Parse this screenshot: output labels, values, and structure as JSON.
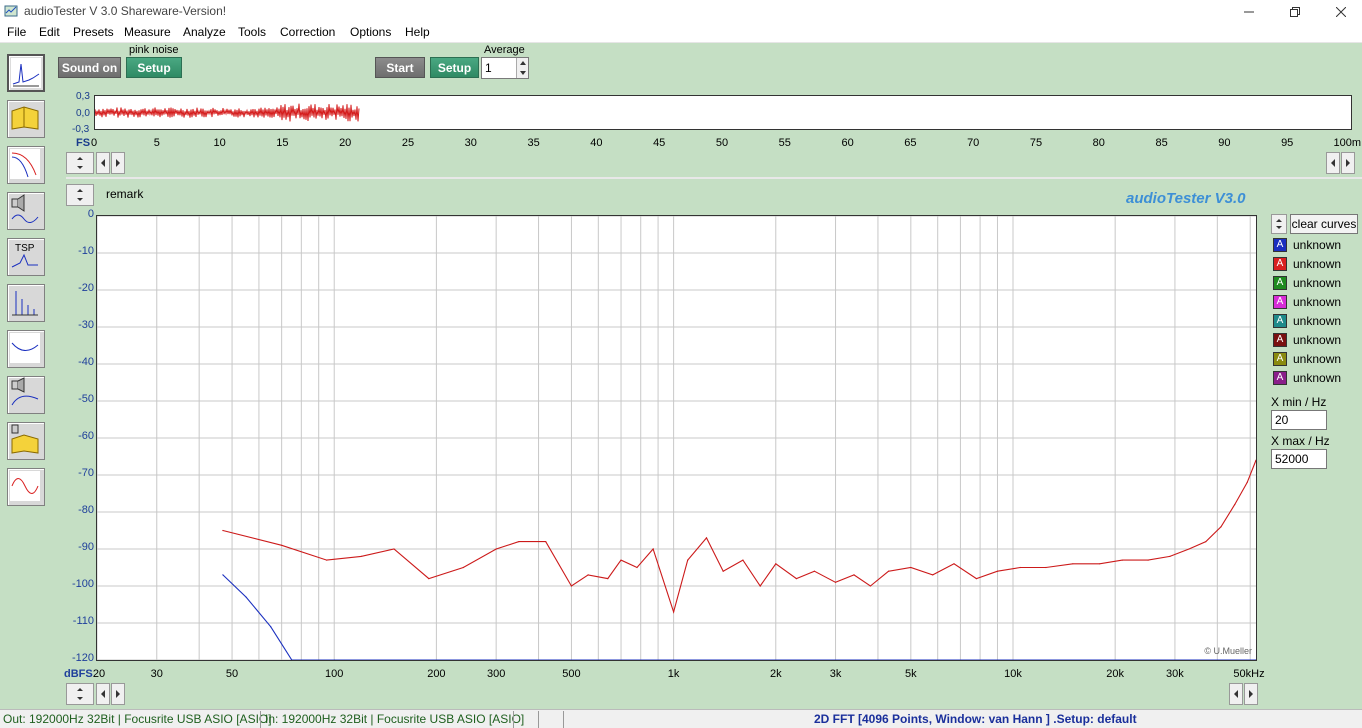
{
  "window": {
    "title": "audioTester  V 3.0 Shareware-Version!"
  },
  "menu": [
    "File",
    "Edit",
    "Presets",
    "Measure",
    "Analyze",
    "Tools",
    "Correction",
    "Options",
    "Help"
  ],
  "generator": {
    "label": "pink noise",
    "sound_button": "Sound on",
    "setup_button": "Setup"
  },
  "measure": {
    "start_button": "Start",
    "setup_button": "Setup",
    "average_label": "Average",
    "average_value": "1"
  },
  "wave": {
    "y_labels": [
      "0,3",
      "0,0",
      "-0,3"
    ],
    "fs_label": "FS",
    "x_ticks": [
      "0",
      "5",
      "10",
      "15",
      "20",
      "25",
      "30",
      "35",
      "40",
      "45",
      "50",
      "55",
      "60",
      "65",
      "70",
      "75",
      "80",
      "85",
      "90",
      "95",
      "100m"
    ],
    "recorded_fraction": 0.21
  },
  "remark_label": "remark",
  "brand": "audioTester  V3.0",
  "copyright": "© U.Mueller",
  "plot": {
    "y_labels": [
      "0",
      "-10",
      "-20",
      "-30",
      "-40",
      "-50",
      "-60",
      "-70",
      "-80",
      "-90",
      "-100",
      "-110",
      "-120"
    ],
    "y_unit": "dBFS",
    "x_labels": [
      "20",
      "30",
      "50",
      "100",
      "200",
      "300",
      "500",
      "1k",
      "2k",
      "3k",
      "5k",
      "10k",
      "20k",
      "30k",
      "50kHz"
    ]
  },
  "chart_data": {
    "type": "line",
    "title": "",
    "xlabel": "",
    "ylabel": "dBFS",
    "xscale": "log",
    "xlim": [
      20,
      52000
    ],
    "ylim": [
      -120,
      0
    ],
    "grid": true,
    "series": [
      {
        "color": "#cc1a1a",
        "x": [
          47,
          70,
          95,
          120,
          150,
          190,
          240,
          300,
          350,
          420,
          500,
          560,
          640,
          700,
          780,
          870,
          1000,
          1100,
          1250,
          1400,
          1600,
          1800,
          2000,
          2300,
          2600,
          3000,
          3400,
          3800,
          4300,
          5000,
          5800,
          6700,
          7800,
          9000,
          10500,
          12500,
          15000,
          18000,
          21000,
          25000,
          29000,
          33000,
          37000,
          41000,
          45000,
          49000,
          52000
        ],
        "y": [
          -85,
          -89,
          -93,
          -92,
          -90,
          -98,
          -95,
          -90,
          -88,
          -88,
          -100,
          -97,
          -98,
          -93,
          -95,
          -90,
          -107,
          -93,
          -87,
          -96,
          -93,
          -100,
          -94,
          -98,
          -96,
          -99,
          -97,
          -100,
          -96,
          -95,
          -97,
          -94,
          -98,
          -96,
          -95,
          -95,
          -94,
          -94,
          -93,
          -93,
          -92,
          -90,
          -88,
          -84,
          -78,
          -72,
          -66
        ]
      },
      {
        "color": "#1a2fbf",
        "x": [
          47,
          55,
          65,
          75,
          100,
          1000,
          52000
        ],
        "y": [
          -97,
          -103,
          -111,
          -120,
          -120,
          -120,
          -120
        ]
      }
    ]
  },
  "curves": {
    "clear_button": "clear curves",
    "items": [
      {
        "label": "unknown",
        "color": "#1a2fbf"
      },
      {
        "label": "unknown",
        "color": "#d92020"
      },
      {
        "label": "unknown",
        "color": "#1f8a1f"
      },
      {
        "label": "unknown",
        "color": "#d62cd6"
      },
      {
        "label": "unknown",
        "color": "#1f8a8a"
      },
      {
        "label": "unknown",
        "color": "#7a1010"
      },
      {
        "label": "unknown",
        "color": "#8a8a10"
      },
      {
        "label": "unknown",
        "color": "#8a1f8a"
      }
    ],
    "xmin_label": "X min / Hz",
    "xmin_value": "20",
    "xmax_label": "X max / Hz",
    "xmax_value": "52000"
  },
  "status": {
    "out": "Out: 192000Hz 32Bit  | Focusrite USB ASIO [ASIO]",
    "in": "In: 192000Hz 32Bit  | Focusrite USB ASIO [ASIO]",
    "mode": "2D FFT [4096 Points, Window: van Hann ]  .Setup:  default"
  }
}
